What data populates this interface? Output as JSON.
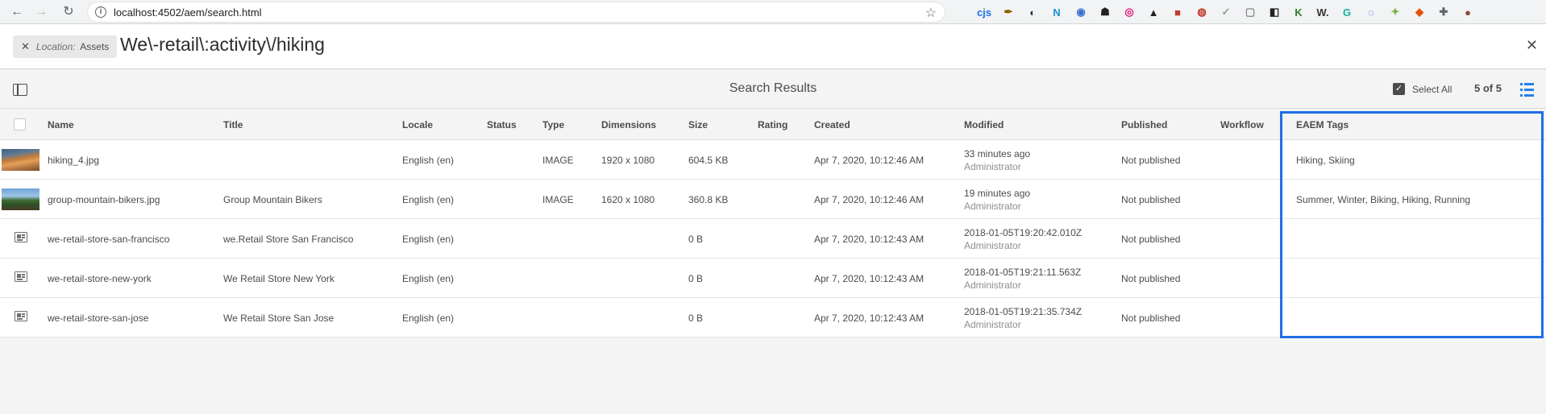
{
  "browser": {
    "url": "localhost:4502/aem/search.html",
    "extensions": [
      {
        "label": "cjs",
        "color": "#1a73e8"
      },
      {
        "label": "✒",
        "color": "#8a5a00"
      },
      {
        "label": "◐",
        "color": "#333333"
      },
      {
        "label": "N",
        "color": "#1a8fd8"
      },
      {
        "label": "◉",
        "color": "#3b6fd1"
      },
      {
        "label": "☗",
        "color": "#222222"
      },
      {
        "label": "◎",
        "color": "#e0157a"
      },
      {
        "label": "▲",
        "color": "#222222"
      },
      {
        "label": "■",
        "color": "#c0392b"
      },
      {
        "label": "◍",
        "color": "#c0392b"
      },
      {
        "label": "✓",
        "color": "#999999"
      },
      {
        "label": "▢",
        "color": "#888888"
      },
      {
        "label": "◧",
        "color": "#222222"
      },
      {
        "label": "K",
        "color": "#2e7d32"
      },
      {
        "label": "W.",
        "color": "#333333"
      },
      {
        "label": "G",
        "color": "#15b29f"
      },
      {
        "label": "◌",
        "color": "#3b5bdb"
      },
      {
        "label": "✦",
        "color": "#7cb342"
      },
      {
        "label": "◆",
        "color": "#e65100"
      },
      {
        "label": "✚",
        "color": "#5f6368"
      },
      {
        "label": "●",
        "color": "#8d4a3a"
      }
    ]
  },
  "omnisearch": {
    "location_label": "Location:",
    "location_value": "Assets",
    "query": "We\\-retail\\:activity\\/hiking"
  },
  "action_bar": {
    "title": "Search Results",
    "select_all": "Select All",
    "count": "5 of 5"
  },
  "table": {
    "columns": [
      "Name",
      "Title",
      "Locale",
      "Status",
      "Type",
      "Dimensions",
      "Size",
      "Rating",
      "Created",
      "Modified",
      "Published",
      "Workflow",
      "EAEM Tags"
    ],
    "rows": [
      {
        "thumb": "photo-1",
        "name": "hiking_4.jpg",
        "title": "",
        "locale": "English (en)",
        "status": "",
        "type": "IMAGE",
        "dimensions": "1920 x 1080",
        "size": "604.5 KB",
        "rating": "",
        "created": "Apr 7, 2020, 10:12:46 AM",
        "modified": "33 minutes ago",
        "modified_by": "Administrator",
        "published": "Not published",
        "workflow": "",
        "tags": "Hiking, Skiing"
      },
      {
        "thumb": "photo-2",
        "name": "group-mountain-bikers.jpg",
        "title": "Group Mountain Bikers",
        "locale": "English (en)",
        "status": "",
        "type": "IMAGE",
        "dimensions": "1620 x 1080",
        "size": "360.8 KB",
        "rating": "",
        "created": "Apr 7, 2020, 10:12:46 AM",
        "modified": "19 minutes ago",
        "modified_by": "Administrator",
        "published": "Not published",
        "workflow": "",
        "tags": "Summer, Winter, Biking, Hiking, Running"
      },
      {
        "thumb": "page",
        "name": "we-retail-store-san-francisco",
        "title": "we.Retail Store San Francisco",
        "locale": "English (en)",
        "status": "",
        "type": "",
        "dimensions": "",
        "size": "0 B",
        "rating": "",
        "created": "Apr 7, 2020, 10:12:43 AM",
        "modified": "2018-01-05T19:20:42.010Z",
        "modified_by": "Administrator",
        "published": "Not published",
        "workflow": "",
        "tags": ""
      },
      {
        "thumb": "page",
        "name": "we-retail-store-new-york",
        "title": "We Retail Store New York",
        "locale": "English (en)",
        "status": "",
        "type": "",
        "dimensions": "",
        "size": "0 B",
        "rating": "",
        "created": "Apr 7, 2020, 10:12:43 AM",
        "modified": "2018-01-05T19:21:11.563Z",
        "modified_by": "Administrator",
        "published": "Not published",
        "workflow": "",
        "tags": ""
      },
      {
        "thumb": "page",
        "name": "we-retail-store-san-jose",
        "title": "We Retail Store San Jose",
        "locale": "English (en)",
        "status": "",
        "type": "",
        "dimensions": "",
        "size": "0 B",
        "rating": "",
        "created": "Apr 7, 2020, 10:12:43 AM",
        "modified": "2018-01-05T19:21:35.734Z",
        "modified_by": "Administrator",
        "published": "Not published",
        "workflow": "",
        "tags": ""
      }
    ]
  },
  "colors": {
    "accent": "#2680eb",
    "highlight_border": "#1f6fe5"
  }
}
